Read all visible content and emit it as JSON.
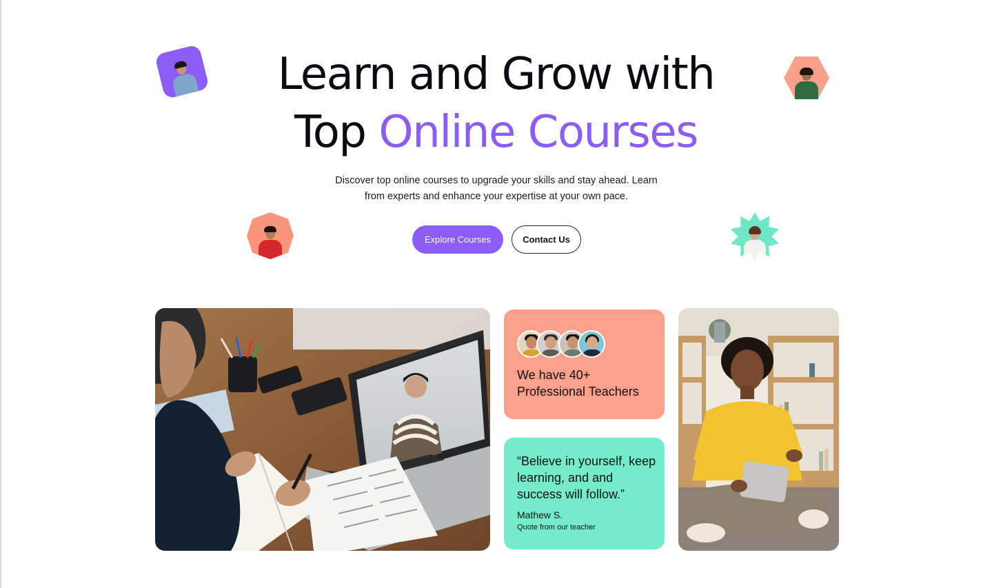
{
  "hero": {
    "title_line1": "Learn and Grow with",
    "title_line2_plain": "Top ",
    "title_line2_accent": "Online Courses",
    "subtitle": "Discover top online courses to upgrade your skills and stay ahead. Learn from experts and enhance your expertise at your own pace.",
    "primary_button": "Explore Courses",
    "secondary_button": "Contact Us"
  },
  "stats_card": {
    "text": "We have 40+ Professional Teachers"
  },
  "quote_card": {
    "quote": "“Believe in yourself, keep learning, and and success will follow.”",
    "author": "Mathew S.",
    "role": "Quote from our teacher"
  },
  "colors": {
    "accent": "#8b5cf6",
    "coral": "#fba08a",
    "mint": "#74ecc9",
    "text": "#0b0b14"
  },
  "images": {
    "main_photo": "student-writing-laptop-video-call",
    "side_photo": "teen-with-tablet"
  }
}
